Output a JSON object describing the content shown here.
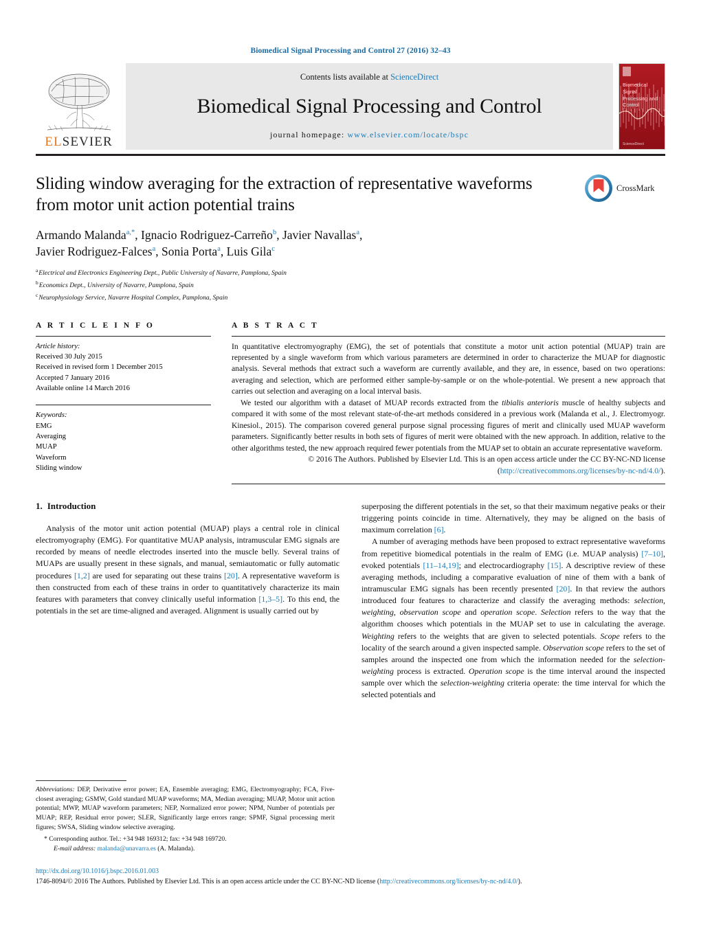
{
  "running_head": "Biomedical Signal Processing and Control 27 (2016) 32–43",
  "masthead": {
    "publisher": "ELSEVIER",
    "contents_prefix": "Contents lists available at ",
    "contents_link": "ScienceDirect",
    "journal_title": "Biomedical Signal Processing and Control",
    "homepage_prefix": "journal homepage: ",
    "homepage_url": "www.elsevier.com/locate/bspc",
    "cover_title": "Biomedical Signal Processing and Control",
    "cover_footer": "ScienceDirect",
    "cover_color": "#9d1119",
    "link_color": "#1a7bb9"
  },
  "crossmark": {
    "label": "CrossMark"
  },
  "title": "Sliding window averaging for the extraction of representative waveforms from motor unit action potential trains",
  "authors": [
    {
      "name": "Armando Malanda",
      "marks": "a,*"
    },
    {
      "name": "Ignacio Rodriguez-Carreño",
      "marks": "b"
    },
    {
      "name": "Javier Navallas",
      "marks": "a"
    },
    {
      "name": "Javier Rodriguez-Falces",
      "marks": "a"
    },
    {
      "name": "Sonia Porta",
      "marks": "a"
    },
    {
      "name": "Luis Gila",
      "marks": "c"
    }
  ],
  "affiliations": [
    {
      "mark": "a",
      "text": "Electrical and Electronics Engineering Dept., Public University of Navarre, Pamplona, Spain"
    },
    {
      "mark": "b",
      "text": "Economics Dept., University of Navarre, Pamplona, Spain"
    },
    {
      "mark": "c",
      "text": "Neurophysiology Service, Navarre Hospital Complex, Pamplona, Spain"
    }
  ],
  "article_info": {
    "heading": "A R T I C L E   I N F O",
    "history_title": "Article history:",
    "history": [
      "Received 30 July 2015",
      "Received in revised form 1 December 2015",
      "Accepted 7 January 2016",
      "Available online 14 March 2016"
    ],
    "keywords_title": "Keywords:",
    "keywords": [
      "EMG",
      "Averaging",
      "MUAP",
      "Waveform",
      "Sliding window"
    ]
  },
  "abstract": {
    "heading": "A B S T R A C T",
    "paragraph_1": "In quantitative electromyography (EMG), the set of potentials that constitute a motor unit action potential (MUAP) train are represented by a single waveform from which various parameters are determined in order to characterize the MUAP for diagnostic analysis. Several methods that extract such a waveform are currently available, and they are, in essence, based on two operations: averaging and selection, which are performed either sample-by-sample or on the whole-potential. We present a new approach that carries out selection and averaging on a local interval basis.",
    "paragraph_2_part1": "We tested our algorithm with a dataset of MUAP records extracted from the ",
    "paragraph_2_italic": "tibialis anterioris",
    "paragraph_2_part2": " muscle of healthy subjects and compared it with some of the most relevant state-of-the-art methods considered in a previous work (Malanda et al., J. Electromyogr. Kinesiol., 2015). The comparison covered general purpose signal processing figures of merit and clinically used MUAP waveform parameters. Significantly better results in both sets of figures of merit were obtained with the new approach. In addition, relative to the other algorithms tested, the new approach required fewer potentials from the MUAP set to obtain an accurate representative waveform.",
    "copyright_part1": "© 2016 The Authors. Published by Elsevier Ltd. This is an open access article under the CC BY-NC-ND license (",
    "copyright_link": "http://creativecommons.org/licenses/by-nc-nd/4.0/",
    "copyright_part2": ")."
  },
  "sections": {
    "intro_number": "1.",
    "intro_title": "Introduction"
  },
  "body": {
    "left_p1_a": "Analysis of the motor unit action potential (MUAP) plays a central role in clinical electromyography (EMG). For quantitative MUAP analysis, intramuscular EMG signals are recorded by means of needle electrodes inserted into the muscle belly. Several trains of MUAPs are usually present in these signals, and manual, semiautomatic or fully automatic procedures ",
    "left_ref1": "[1,2]",
    "left_p1_b": " are used for separating out these trains ",
    "left_ref2": "[20]",
    "left_p1_c": ". A representative waveform is then constructed from each of these trains in order to quantitatively characterize its main features with parameters that convey clinically useful information ",
    "left_ref3": "[1,3–5]",
    "left_p1_d": ". To this end, the potentials in the set are time-aligned and averaged. Alignment is usually carried out by",
    "right_p1_a": "superposing the different potentials in the set, so that their maximum negative peaks or their triggering points coincide in time. Alternatively, they may be aligned on the basis of maximum correlation ",
    "right_ref1": "[6]",
    "right_p1_b": ".",
    "right_p2_a": "A number of averaging methods have been proposed to extract representative waveforms from repetitive biomedical potentials in the realm of EMG (i.e. MUAP analysis) ",
    "right_ref2": "[7–10]",
    "right_p2_b": ", evoked potentials ",
    "right_ref3": "[11–14,19]",
    "right_p2_c": "; and electrocardiography ",
    "right_ref4": "[15]",
    "right_p2_d": ". A descriptive review of these averaging methods, including a comparative evaluation of nine of them with a bank of intramuscular EMG signals has been recently presented ",
    "right_ref5": "[20]",
    "right_p2_e": ". In that review the authors introduced four features to characterize and classify the averaging methods: ",
    "right_it1": "selection, weighting, observation scope",
    "right_p2_f": " and ",
    "right_it2": "operation scope",
    "right_p2_g": ". ",
    "right_it3": "Selection",
    "right_p2_h": " refers to the way that the algorithm chooses which potentials in the MUAP set to use in calculating the average. ",
    "right_it4": "Weighting",
    "right_p2_i": " refers to the weights that are given to selected potentials. ",
    "right_it5": "Scope",
    "right_p2_j": " refers to the locality of the search around a given inspected sample. ",
    "right_it6": "Observation scope",
    "right_p2_k": " refers to the set of samples around the inspected one from which the information needed for the ",
    "right_it7": "selection-weighting",
    "right_p2_l": " process is extracted. ",
    "right_it8": "Operation scope",
    "right_p2_m": " is the time interval around the inspected sample over which the ",
    "right_it9": "selection-weighting",
    "right_p2_n": " criteria operate: the time interval for which the selected potentials and"
  },
  "footnotes": {
    "abbrev_title": "Abbreviations:",
    "abbrev_text": " DEP, Derivative error power; EA, Ensemble averaging; EMG, Electromyography; FCA, Five-closest averaging; GSMW, Gold standard MUAP waveforms; MA, Median averaging; MUAP, Motor unit action potential; MWP, MUAP waveform parameters; NEP, Normalized error power; NPM, Number of potentials per MUAP; REP, Residual error power; SLER, Significantly large errors range; SPMF, Signal processing merit figures; SWSA, Sliding window selective averaging.",
    "corresponding": "* Corresponding author. Tel.: +34 948 169312; fax: +34 948 169720.",
    "email_label": "E-mail address:",
    "email_address": "malanda@unavarra.es",
    "email_suffix": " (A. Malanda)."
  },
  "page_footer": {
    "doi": "http://dx.doi.org/10.1016/j.bspc.2016.01.003",
    "issn_copy_part1": "1746-8094/© 2016 The Authors. Published by Elsevier Ltd. This is an open access article under the CC BY-NC-ND license (",
    "issn_copy_link": "http://creativecommons.org/licenses/by-nc-nd/4.0/",
    "issn_copy_part2": ")."
  }
}
